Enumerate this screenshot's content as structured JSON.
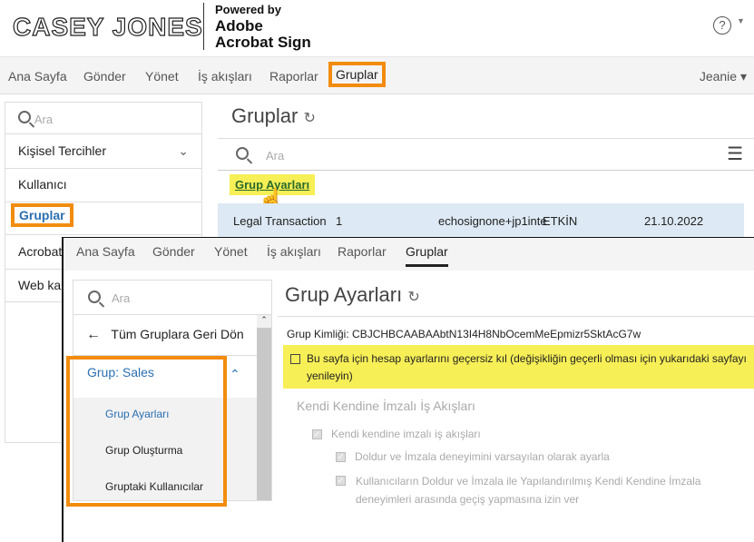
{
  "header": {
    "logo": "CASEY JONES",
    "powered_by": "Powered by",
    "brand1": "Adobe",
    "brand2": "Acrobat Sign",
    "help_icon": "?"
  },
  "nav": {
    "items": [
      "Ana Sayfa",
      "Gönder",
      "Yönet",
      "İş akışları",
      "Raporlar",
      "Gruplar"
    ],
    "user": "Jeanie"
  },
  "left": {
    "search_placeholder": "Ara",
    "items": [
      "Kişisel Tercihler",
      "Kullanıcı",
      "Gruplar",
      "Acrobat",
      "Web kan"
    ]
  },
  "groups": {
    "title": "Gruplar",
    "search_placeholder": "Ara",
    "link": "Grup Ayarları",
    "row": {
      "name": "Legal Transaction",
      "count": "1",
      "email": "echosignone+jp1inte",
      "status": "ETKİN",
      "date": "21.10.2022"
    }
  },
  "overlay": {
    "nav": [
      "Ana Sayfa",
      "Gönder",
      "Yönet",
      "İş akışları",
      "Raporlar",
      "Gruplar"
    ],
    "sidebar": {
      "search_placeholder": "Ara",
      "back": "Tüm Gruplara Geri Dön",
      "group": "Grup: Sales",
      "sub": [
        "Grup Ayarları",
        "Grup Oluşturma",
        "Gruptaki Kullanıcılar"
      ]
    },
    "title": "Grup Ayarları",
    "id_label": "Grup Kimliği:",
    "id_value": "CBJCHBCAABAAbtN13I4H8NbOcemMeEpmizr5SktAcG7w",
    "override": "Bu sayfa için hesap ayarlarını geçersiz kıl (değişikliğin geçerli olması için yukarıdaki sayfayı yenileyin)",
    "section": "Kendi Kendine İmzalı İş Akışları",
    "opt1": "Kendi kendine imzalı iş akışları",
    "opt2": "Doldur ve İmzala deneyimini varsayılan olarak ayarla",
    "opt3": "Kullanıcıların Doldur ve İmzala ile Yapılandırılmış Kendi Kendine İmzala deneyimleri arasında geçiş yapmasına izin ver"
  },
  "colors": {
    "highlight": "#f28c0f",
    "yellow": "#f7ef56",
    "link_blue": "#2a6fb0"
  }
}
